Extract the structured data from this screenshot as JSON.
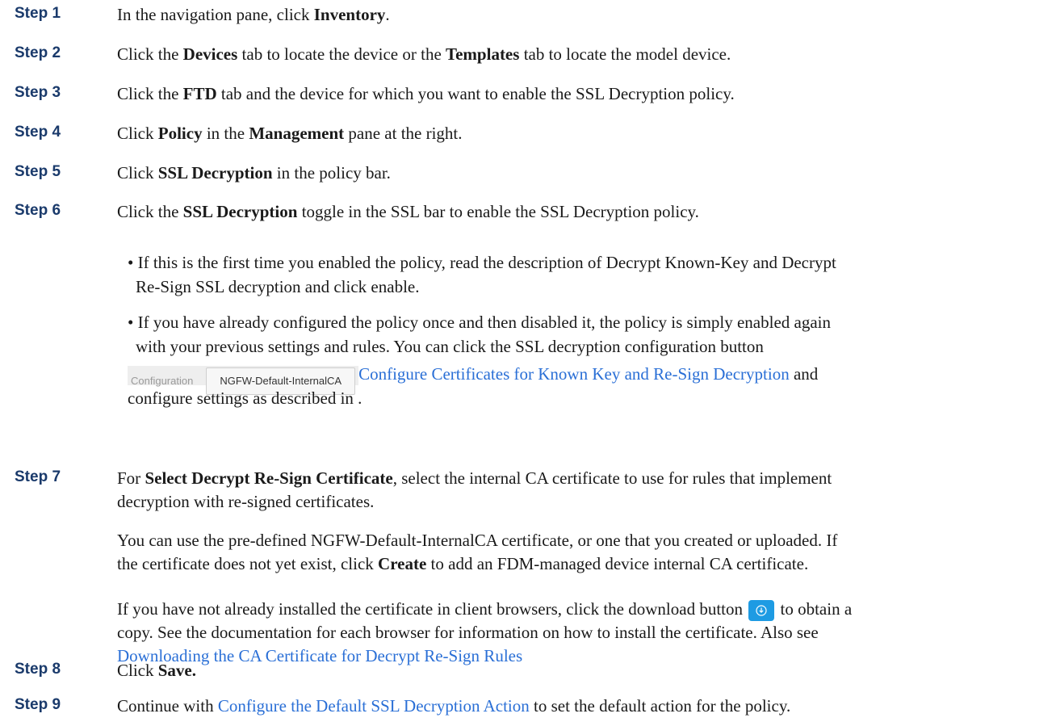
{
  "steps": [
    {
      "label": "Step 1",
      "pre": "In the navigation pane, click ",
      "b1": "Inventory",
      "post": "."
    },
    {
      "label": "Step 2",
      "p1": "Click the ",
      "b1": "Devices",
      "p2": " tab to locate the device or the ",
      "b2": "Templates",
      "p3": " tab to locate the model device."
    },
    {
      "label": "Step 3",
      "p1": "Click the ",
      "b1": "FTD",
      "p2": " tab and the device for which you want to enable the SSL Decryption policy."
    },
    {
      "label": "Step 4",
      "p1": "Click ",
      "b1": "Policy",
      "p2": " in the ",
      "b2": "Management",
      "p3": " pane at the right."
    },
    {
      "label": "Step 5",
      "p1": "Click ",
      "b1": "SSL Decryption",
      "p2": " in the policy bar."
    },
    {
      "label": "Step 6",
      "p1": "Click the ",
      "b1": "SSL Decryption",
      "p2": " toggle in the SSL bar to enable the SSL Decryption policy."
    },
    {
      "label": "Step 7",
      "p1": "For ",
      "b1": "Select Decrypt Re-Sign Certificate",
      "p2": ", select the internal CA certificate to use for rules that implement",
      "line2": "decryption with re-signed certificates."
    },
    {
      "label": "Step 8",
      "p1": "Click ",
      "b1": "Save."
    },
    {
      "label": "Step 9",
      "p1": "Continue with ",
      "link": "Configure the Default SSL Decryption Action",
      "p2": " to set the default action for the policy."
    }
  ],
  "step6_bullets": {
    "b1_line1": "If this is the first time you enabled the policy, read the description of Decrypt Known-Key and Decrypt",
    "b1_line2": "Re-Sign SSL decryption and click enable.",
    "b2_line1": "If you have already configured the policy once and then disabled it, the policy is simply enabled again",
    "b2_line2": "with your previous settings and rules. You can click the SSL decryption configuration button",
    "config_label": "Configuration",
    "config_value": "NGFW-Default-InternalCA",
    "b2_link": "Configure Certificates for Known Key and Re-Sign Decryption",
    "b2_after_link": " and",
    "b2_line4": "configure settings as described in ."
  },
  "step7_paras": {
    "p1_line1": "You can use the pre-defined NGFW-Default-InternalCA certificate, or one that you created or uploaded. If",
    "p1_line2_pre": "the certificate does not yet exist, click ",
    "p1_line2_bold": "Create",
    "p1_line2_post": " to add an FDM-managed device internal CA certificate.",
    "p2_line1_pre": "If you have not already installed the certificate in client browsers, click the download button ",
    "p2_line1_post": " to obtain a",
    "p2_line2": "copy. See the documentation for each browser for information on how to install the certificate. Also see",
    "p2_link": "Downloading the CA Certificate for Decrypt Re-Sign Rules"
  },
  "icons": {
    "download": "download-icon"
  },
  "colors": {
    "step_label": "#1a3a6b",
    "link": "#2a6fd6",
    "download_button": "#1e9be3"
  }
}
